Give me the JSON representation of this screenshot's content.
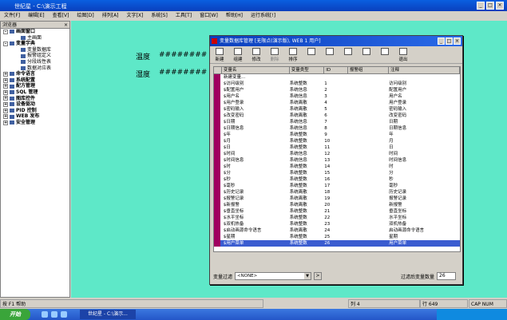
{
  "window": {
    "title": "世纪星 - C:\\演示工程"
  },
  "menu": [
    "文件[F]",
    "编辑[E]",
    "查看[V]",
    "绘图[D]",
    "排列[A]",
    "文字[X]",
    "系统[S]",
    "工具[T]",
    "窗口[W]",
    "帮助[H]",
    "运行系统[!]"
  ],
  "sidebar": {
    "title": "浏览器",
    "close": "×",
    "items": [
      {
        "label": "画面窗口",
        "level": 0,
        "bold": true,
        "pm": "-"
      },
      {
        "label": "主画面",
        "level": 1,
        "bold": false,
        "pm": ""
      },
      {
        "label": "变量字典",
        "level": 0,
        "bold": true,
        "pm": "-"
      },
      {
        "label": "变量数据库",
        "level": 1,
        "bold": false,
        "pm": ""
      },
      {
        "label": "报警组定义",
        "level": 1,
        "bold": false,
        "pm": ""
      },
      {
        "label": "分段线性表",
        "level": 1,
        "bold": false,
        "pm": ""
      },
      {
        "label": "数据对应表",
        "level": 1,
        "bold": false,
        "pm": ""
      },
      {
        "label": "命令语言",
        "level": 0,
        "bold": true,
        "pm": "+"
      },
      {
        "label": "系统配置",
        "level": 0,
        "bold": true,
        "pm": "+"
      },
      {
        "label": "配方管理",
        "level": 0,
        "bold": true,
        "pm": "+"
      },
      {
        "label": "SQL 管理",
        "level": 0,
        "bold": true,
        "pm": "+"
      },
      {
        "label": "图库控件",
        "level": 0,
        "bold": true,
        "pm": "+"
      },
      {
        "label": "设备驱动",
        "level": 0,
        "bold": true,
        "pm": "+"
      },
      {
        "label": "PID 控制",
        "level": 0,
        "bold": true,
        "pm": "+"
      },
      {
        "label": "WEB 发布",
        "level": 0,
        "bold": true,
        "pm": "+"
      },
      {
        "label": "安全管理",
        "level": 0,
        "bold": true,
        "pm": "+"
      }
    ]
  },
  "canvas": {
    "temp_label": "温度",
    "temp_value": "########",
    "hum_label": "湿度",
    "hum_value": "########"
  },
  "dialog": {
    "title": "变量数据库管理 [无限点(演示版), WEB 1 用户]",
    "toolbar": [
      {
        "label": "新建",
        "disabled": false
      },
      {
        "label": "组建",
        "disabled": false
      },
      {
        "label": "修改",
        "disabled": false
      },
      {
        "label": "删除",
        "disabled": true
      },
      {
        "label": "排序",
        "disabled": false
      },
      {
        "label": "",
        "disabled": false
      },
      {
        "label": "",
        "disabled": false
      },
      {
        "label": "",
        "disabled": false
      },
      {
        "label": "",
        "disabled": false
      },
      {
        "label": "",
        "disabled": false
      },
      {
        "label": "退出",
        "disabled": false
      }
    ],
    "columns": [
      "变量名",
      "变量类型",
      "ID",
      "报警组",
      "注释"
    ],
    "new_var": "新建变量...",
    "rows": [
      [
        "$访问级别",
        "系统整数",
        "1",
        "",
        "访问级别"
      ],
      [
        "$配置用户",
        "系统信息",
        "2",
        "",
        "配置用户"
      ],
      [
        "$用户名",
        "系统信息",
        "3",
        "",
        "用户名"
      ],
      [
        "$用户登录",
        "系统离散",
        "4",
        "",
        "用户登录"
      ],
      [
        "$密码输入",
        "系统离散",
        "5",
        "",
        "密码输入"
      ],
      [
        "$改变密码",
        "系统离散",
        "6",
        "",
        "改变密码"
      ],
      [
        "$日期",
        "系统信息",
        "7",
        "",
        "日期"
      ],
      [
        "$日期信息",
        "系统信息",
        "8",
        "",
        "日期信息"
      ],
      [
        "$年",
        "系统整数",
        "9",
        "",
        "年"
      ],
      [
        "$月",
        "系统整数",
        "10",
        "",
        "月"
      ],
      [
        "$日",
        "系统整数",
        "11",
        "",
        "日"
      ],
      [
        "$时间",
        "系统信息",
        "12",
        "",
        "时间"
      ],
      [
        "$时间信息",
        "系统信息",
        "13",
        "",
        "时间信息"
      ],
      [
        "$时",
        "系统整数",
        "14",
        "",
        "时"
      ],
      [
        "$分",
        "系统整数",
        "15",
        "",
        "分"
      ],
      [
        "$秒",
        "系统整数",
        "16",
        "",
        "秒"
      ],
      [
        "$毫秒",
        "系统整数",
        "17",
        "",
        "毫秒"
      ],
      [
        "$历史记录",
        "系统离散",
        "18",
        "",
        "历史记录"
      ],
      [
        "$报警记录",
        "系统离散",
        "19",
        "",
        "报警记录"
      ],
      [
        "$新报警",
        "系统离散",
        "20",
        "",
        "新报警"
      ],
      [
        "$垂直坐标",
        "系统整数",
        "21",
        "",
        "垂直坐标"
      ],
      [
        "$水平坐标",
        "系统整数",
        "22",
        "",
        "水平坐标"
      ],
      [
        "$双机热备",
        "系统整数",
        "23",
        "",
        "双机热备"
      ],
      [
        "$启动画源命令语言",
        "系统离散",
        "24",
        "",
        "启动画源命令语言"
      ],
      [
        "$星期",
        "系统整数",
        "25",
        "",
        "星期"
      ],
      [
        "$用户菜单",
        "系统整数",
        "26",
        "",
        "用户菜单"
      ]
    ],
    "selected_row": 25,
    "filter_label": "变量过滤",
    "filter_value": "<NONE>",
    "count_label": "过滤后变量数量",
    "count_value": "26"
  },
  "status": {
    "help": "按 F1 帮助",
    "col": "列 4",
    "row": "行 649",
    "caps": "CAP NUM"
  },
  "taskbar": {
    "start": "开始",
    "task": "世纪星 - C:\\演示..."
  }
}
